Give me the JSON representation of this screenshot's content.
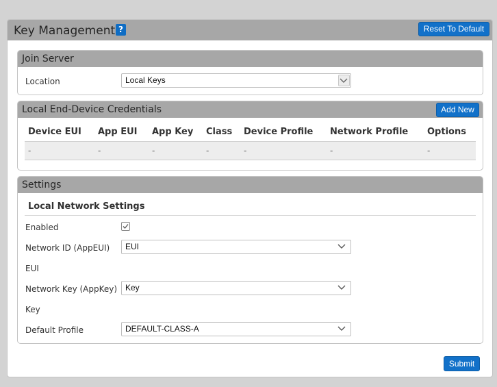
{
  "header": {
    "title": "Key Management",
    "help": "?",
    "reset_label": "Reset To Default"
  },
  "join_server": {
    "title": "Join Server",
    "location_label": "Location",
    "location_value": "Local Keys"
  },
  "credentials": {
    "title": "Local End-Device Credentials",
    "add_label": "Add New",
    "columns": [
      "Device EUI",
      "App EUI",
      "App Key",
      "Class",
      "Device Profile",
      "Network Profile",
      "Options"
    ],
    "rows": [
      [
        "-",
        "-",
        "-",
        "-",
        "-",
        "-",
        "-"
      ]
    ]
  },
  "settings": {
    "title": "Settings",
    "subtitle": "Local Network Settings",
    "enabled_label": "Enabled",
    "enabled": true,
    "network_id_label": "Network ID (AppEUI)",
    "network_id_value": "EUI",
    "network_id_hint": "EUI",
    "network_key_label": "Network Key (AppKey)",
    "network_key_value": "Key",
    "network_key_hint": "Key",
    "profile_label": "Default Profile",
    "profile_value": "DEFAULT-CLASS-A"
  },
  "footer": {
    "submit_label": "Submit"
  },
  "colors": {
    "accent": "#1271c9",
    "header_bg": "#a7a7a7",
    "page_bg": "#d3d3d3"
  }
}
